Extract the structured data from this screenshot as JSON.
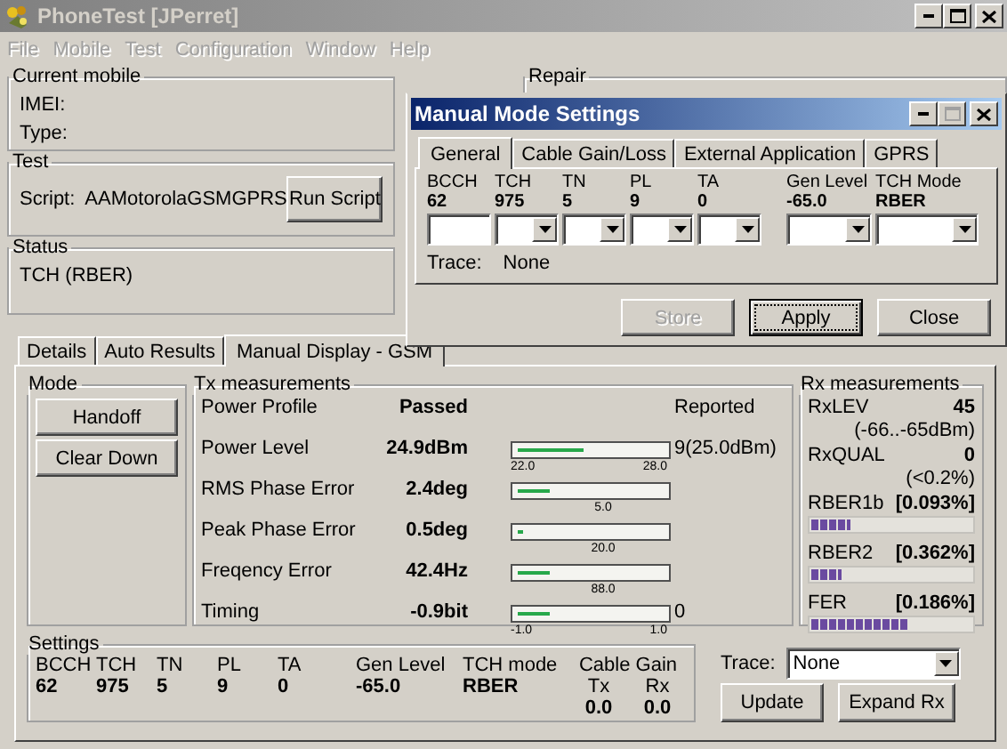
{
  "window": {
    "title": "PhoneTest [JPerret]",
    "active": false
  },
  "menu": [
    {
      "label": "File",
      "disabled": true
    },
    {
      "label": "Mobile",
      "disabled": true
    },
    {
      "label": "Test",
      "disabled": true
    },
    {
      "label": "Configuration",
      "disabled": true
    },
    {
      "label": "Window",
      "disabled": true
    },
    {
      "label": "Help",
      "disabled": true
    }
  ],
  "current_mobile": {
    "title": "Current mobile",
    "fields": [
      {
        "label": "IMEI:"
      },
      {
        "label": "Type:"
      }
    ]
  },
  "test": {
    "title": "Test",
    "script_label": "Script:",
    "script": "AAMotorolaGSMGPRS",
    "button": "Run Script"
  },
  "status": {
    "title": "Status",
    "text": "TCH (RBER)"
  },
  "repair": {
    "title": "Repair"
  },
  "tabs": [
    {
      "label": "Details",
      "selected": false
    },
    {
      "label": "Auto Results",
      "selected": false
    },
    {
      "label": "Manual Display - GSM",
      "selected": true
    }
  ],
  "mode": {
    "title": "Mode",
    "buttons": [
      "Handoff",
      "Clear Down"
    ]
  },
  "tx": {
    "title": "Tx measurements",
    "reported_header": "Reported",
    "rows": [
      {
        "name": "Power Profile",
        "value": "Passed"
      },
      {
        "name": "Power Level",
        "value": "24.9dBm",
        "level": 0.45,
        "ticks": [
          "22.0",
          "28.0"
        ],
        "reported": "9(25.0dBm)"
      },
      {
        "name": "RMS Phase Error",
        "value": "2.4deg",
        "level": 0.22,
        "ticks": [
          "5.0"
        ]
      },
      {
        "name": "Peak Phase Error",
        "value": "0.5deg",
        "level": 0.03,
        "ticks": [
          "20.0"
        ]
      },
      {
        "name": "Freqency Error",
        "value": "42.4Hz",
        "level": 0.22,
        "ticks": [
          "88.0"
        ]
      },
      {
        "name": "Timing",
        "value": "-0.9bit",
        "level": 0.22,
        "ticks": [
          "-1.0",
          "1.0"
        ],
        "reported": "0"
      }
    ]
  },
  "rx": {
    "title": "Rx measurements",
    "items": [
      {
        "kind": "value",
        "label": "RxLEV",
        "value": "45",
        "note": "(-66..-65dBm)"
      },
      {
        "kind": "value",
        "label": "RxQUAL",
        "value": "0",
        "note": "(<0.2%)"
      },
      {
        "kind": "bar",
        "label": "RBER1b",
        "value": "[0.093%]",
        "level": 0.24
      },
      {
        "kind": "bar",
        "label": "RBER2",
        "value": "[0.362%]",
        "level": 0.18
      },
      {
        "kind": "bar",
        "label": "FER",
        "value": "[0.186%]",
        "level": 0.6
      }
    ]
  },
  "settings": {
    "title": "Settings",
    "columns": [
      {
        "label": "BCCH",
        "value": "62"
      },
      {
        "label": "TCH",
        "value": "975"
      },
      {
        "label": "TN",
        "value": "5"
      },
      {
        "label": "PL",
        "value": "9"
      },
      {
        "label": "TA",
        "value": "0"
      },
      {
        "label": "Gen Level",
        "value": "-65.0"
      },
      {
        "label": "TCH mode",
        "value": "RBER"
      }
    ],
    "cable_gain": {
      "title": "Cable Gain",
      "columns": [
        {
          "label": "Tx",
          "value": "0.0"
        },
        {
          "label": "Rx",
          "value": "0.0"
        }
      ]
    },
    "trace_label": "Trace:",
    "trace": "None",
    "buttons": [
      "Update",
      "Expand Rx"
    ]
  },
  "dialog": {
    "title": "Manual Mode Settings",
    "tabs": [
      {
        "label": "General",
        "selected": true
      },
      {
        "label": "Cable Gain/Loss",
        "selected": false
      },
      {
        "label": "External Application",
        "selected": false
      },
      {
        "label": "GPRS",
        "selected": false
      }
    ],
    "fields": [
      {
        "label": "BCCH",
        "value": "62",
        "kind": "text"
      },
      {
        "label": "TCH",
        "value": "975",
        "kind": "combo"
      },
      {
        "label": "TN",
        "value": "5",
        "kind": "combo"
      },
      {
        "label": "PL",
        "value": "9",
        "kind": "combo"
      },
      {
        "label": "TA",
        "value": "0",
        "kind": "combo"
      },
      {
        "label": "Gen Level",
        "value": "-65.0",
        "kind": "combo"
      },
      {
        "label": "TCH Mode",
        "value": "RBER",
        "kind": "combo"
      }
    ],
    "trace_label": "Trace:",
    "trace": "None",
    "buttons": [
      {
        "label": "Store",
        "disabled": true,
        "focused": false
      },
      {
        "label": "Apply",
        "disabled": false,
        "focused": true
      },
      {
        "label": "Close",
        "disabled": false,
        "focused": false
      }
    ]
  }
}
